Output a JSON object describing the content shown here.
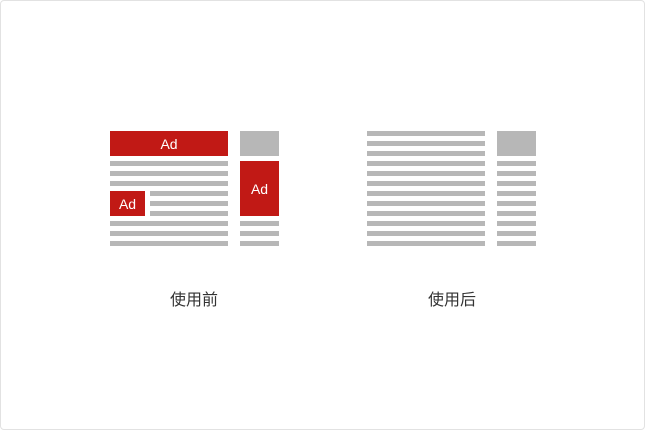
{
  "colors": {
    "ad": "#c11915",
    "placeholder": "#b7b7b7"
  },
  "before": {
    "caption": "使用前",
    "ad_label_top": "Ad",
    "ad_label_inline": "Ad",
    "ad_label_side": "Ad"
  },
  "after": {
    "caption": "使用后"
  }
}
